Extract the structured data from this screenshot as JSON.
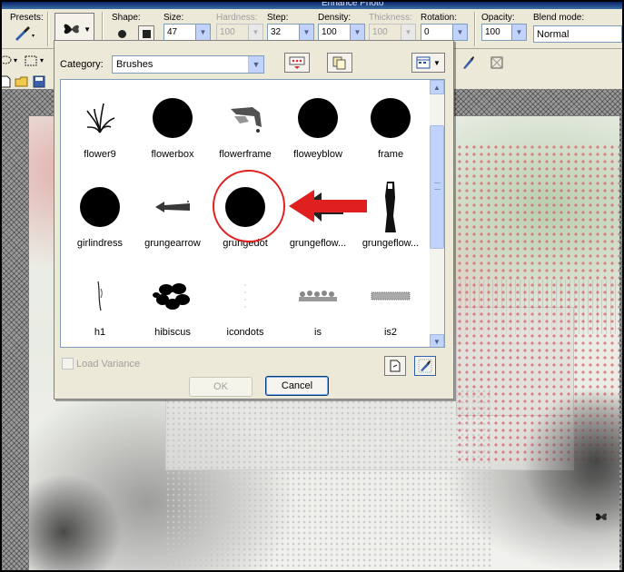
{
  "app": {
    "title_fragment": "Enhance Photo"
  },
  "options_bar": {
    "presets_label": "Presets:",
    "shape_label": "Shape:",
    "size_label": "Size:",
    "size_value": "47",
    "hardness_label": "Hardness:",
    "hardness_value": "100",
    "step_label": "Step:",
    "step_value": "32",
    "density_label": "Density:",
    "density_value": "100",
    "thickness_label": "Thickness:",
    "thickness_value": "100",
    "rotation_label": "Rotation:",
    "rotation_value": "0",
    "opacity_label": "Opacity:",
    "opacity_value": "100",
    "blend_mode_label": "Blend mode:",
    "blend_mode_value": "Normal"
  },
  "dialog": {
    "category_label": "Category:",
    "category_value": "Brushes",
    "load_variance_label": "Load Variance",
    "load_variance_checked": false,
    "ok_label": "OK",
    "cancel_label": "Cancel",
    "brushes": [
      {
        "label": "flower9",
        "icon": "grass-brush-icon"
      },
      {
        "label": "flowerbox",
        "icon": "round-brush-icon"
      },
      {
        "label": "flowerframe",
        "icon": "frame-brush-icon"
      },
      {
        "label": "floweyblow",
        "icon": "round-brush-icon"
      },
      {
        "label": "frame",
        "icon": "round-brush-icon"
      },
      {
        "label": "girlindress",
        "icon": "round-brush-icon"
      },
      {
        "label": "grungearrow",
        "icon": "grunge-arrow-icon"
      },
      {
        "label": "grungedot",
        "icon": "round-brush-icon"
      },
      {
        "label": "grungeflow...",
        "icon": "grunge-arrow-left-icon"
      },
      {
        "label": "grungeflow...",
        "icon": "grunge-stroke-icon"
      },
      {
        "label": "h1",
        "icon": "thin-stroke-icon"
      },
      {
        "label": "hibiscus",
        "icon": "hibiscus-icon"
      },
      {
        "label": "icondots",
        "icon": "faint-dots-icon"
      },
      {
        "label": "is",
        "icon": "scroll-border-icon"
      },
      {
        "label": "is2",
        "icon": "texture-strip-icon"
      }
    ],
    "selected_highlight": "grungedot"
  },
  "colors": {
    "highlight": "#e02020",
    "window_bg": "#ece9d8",
    "input_border": "#7f9db9",
    "accent_blue": "#c1d3fb"
  }
}
